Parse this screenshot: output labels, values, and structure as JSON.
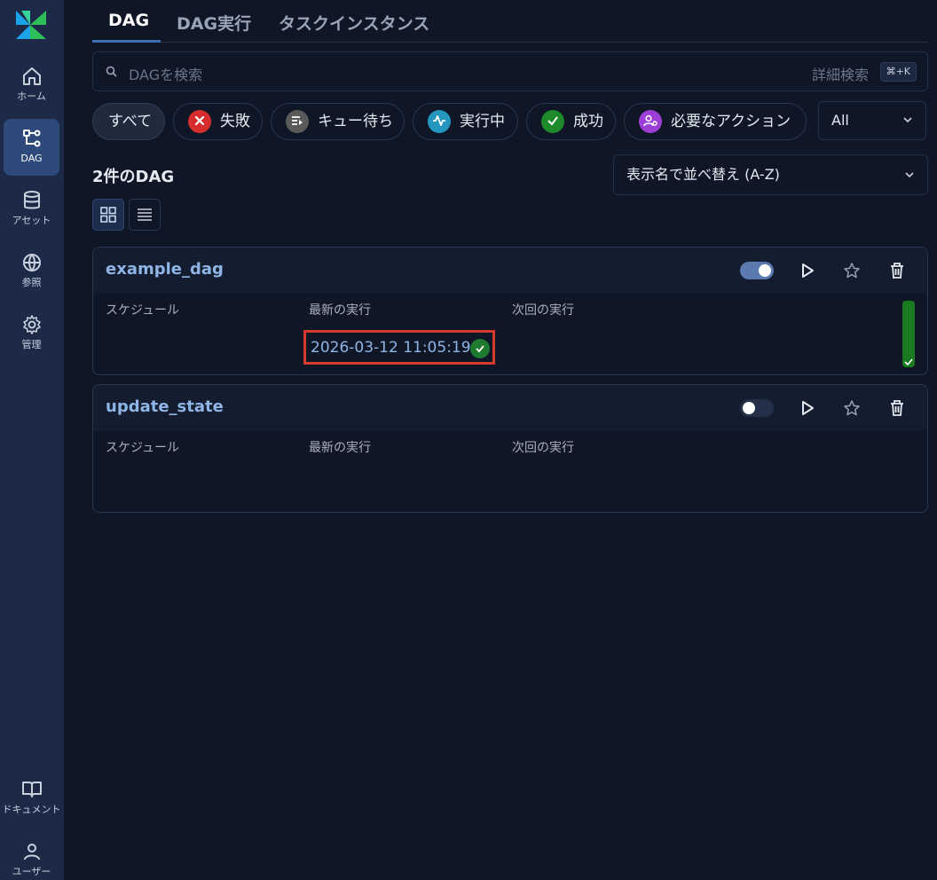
{
  "sidebar": {
    "items": [
      {
        "label": "ホーム",
        "icon": "home-icon"
      },
      {
        "label": "DAG",
        "icon": "dag-icon",
        "active": true
      },
      {
        "label": "アセット",
        "icon": "database-icon"
      },
      {
        "label": "参照",
        "icon": "globe-icon"
      },
      {
        "label": "管理",
        "icon": "gear-icon"
      }
    ],
    "bottom": [
      {
        "label": "ドキュメント",
        "icon": "book-icon"
      },
      {
        "label": "ユーザー",
        "icon": "user-icon"
      }
    ]
  },
  "tabs": [
    {
      "label": "DAG",
      "active": true
    },
    {
      "label": "DAG実行"
    },
    {
      "label": "タスクインスタンス"
    }
  ],
  "search": {
    "placeholder": "DAGを検索",
    "advanced_label": "詳細検索",
    "shortcut": "⌘+K"
  },
  "filters": [
    {
      "label": "すべて",
      "active": true
    },
    {
      "label": "失敗",
      "icon": "x-circle-icon",
      "color": "#d62d2d"
    },
    {
      "label": "キュー待ち",
      "icon": "queue-icon",
      "color": "#5a5a5a"
    },
    {
      "label": "実行中",
      "icon": "activity-icon",
      "color": "#2596be"
    },
    {
      "label": "成功",
      "icon": "check-circle-icon",
      "color": "#1f8a2b"
    },
    {
      "label": "必要なアクション",
      "icon": "user-action-icon",
      "color": "#9b3fd6"
    }
  ],
  "state_select": {
    "value": "All"
  },
  "summary": {
    "count_title": "2件のDAG"
  },
  "sort": {
    "value": "表示名で並べ替え (A-Z)"
  },
  "dags": [
    {
      "name": "example_dag",
      "enabled": true,
      "schedule_label": "スケジュール",
      "last_run_label": "最新の実行",
      "next_run_label": "次回の実行",
      "last_run": "2026-03-12 11:05:19",
      "last_run_state": "success"
    },
    {
      "name": "update_state",
      "enabled": false,
      "schedule_label": "スケジュール",
      "last_run_label": "最新の実行",
      "next_run_label": "次回の実行"
    }
  ],
  "colors": {
    "accent": "#3b6fb6",
    "link": "#8fb4e6",
    "success": "#1a7a1f",
    "highlight": "#d63a2a"
  }
}
